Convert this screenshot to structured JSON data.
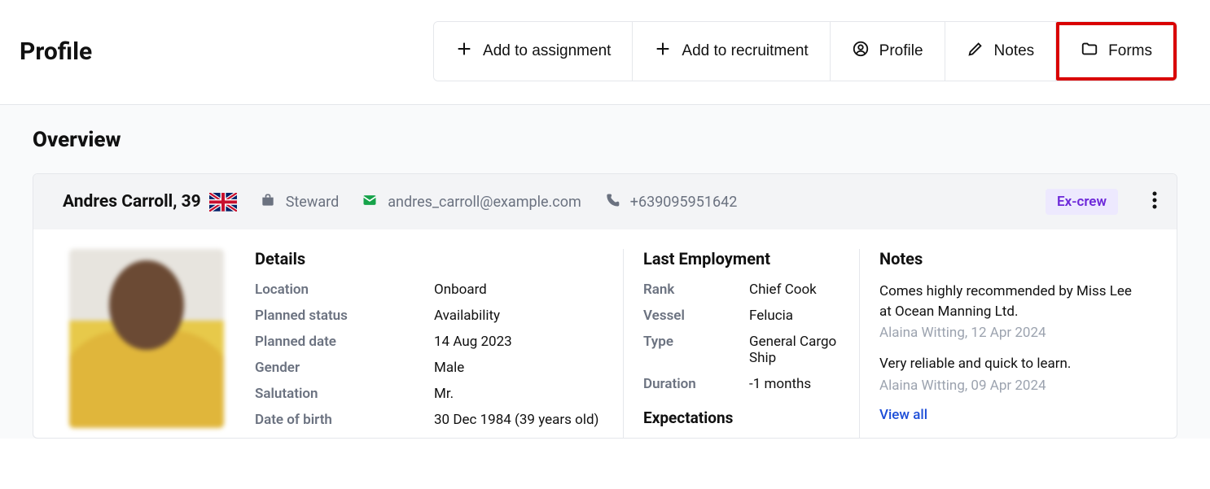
{
  "header": {
    "title": "Profile",
    "buttons": {
      "assignment": "Add to assignment",
      "recruitment": "Add to recruitment",
      "profile": "Profile",
      "notes": "Notes",
      "forms": "Forms"
    }
  },
  "overview": {
    "title": "Overview",
    "person": {
      "name_age": "Andres Carroll, 39",
      "role": "Steward",
      "email": "andres_carroll@example.com",
      "phone": "+639095951642",
      "badge": "Ex-crew"
    },
    "details": {
      "title": "Details",
      "rows": [
        {
          "key": "Location",
          "val": "Onboard"
        },
        {
          "key": "Planned status",
          "val": "Availability"
        },
        {
          "key": "Planned date",
          "val": "14 Aug 2023"
        },
        {
          "key": "Gender",
          "val": "Male"
        },
        {
          "key": "Salutation",
          "val": "Mr."
        },
        {
          "key": "Date of birth",
          "val": "30 Dec 1984 (39 years old)"
        }
      ]
    },
    "employment": {
      "title": "Last Employment",
      "rows": [
        {
          "key": "Rank",
          "val": "Chief Cook"
        },
        {
          "key": "Vessel",
          "val": "Felucia"
        },
        {
          "key": "Type",
          "val": "General Cargo Ship"
        },
        {
          "key": "Duration",
          "val": "-1 months"
        }
      ],
      "expectations_title": "Expectations"
    },
    "notes": {
      "title": "Notes",
      "items": [
        {
          "text": "Comes highly recommended by Miss Lee at Ocean Manning Ltd.",
          "meta": "Alaina Witting, 12 Apr 2024"
        },
        {
          "text": "Very reliable and quick to learn.",
          "meta": "Alaina Witting, 09 Apr 2024"
        }
      ],
      "view_all": "View all"
    }
  }
}
